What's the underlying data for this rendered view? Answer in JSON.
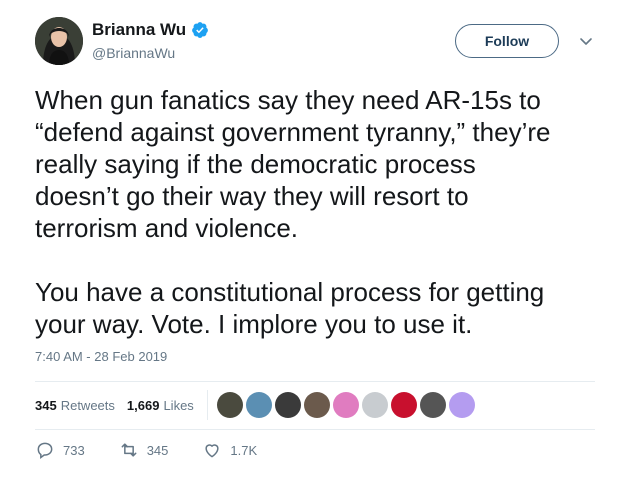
{
  "author": {
    "display_name": "Brianna Wu",
    "handle": "@BriannaWu",
    "verified_icon": "verified-badge-icon",
    "accent": "#1da1f2"
  },
  "header": {
    "follow_label": "Follow",
    "menu_icon": "chevron-down-icon"
  },
  "tweet": {
    "text": "When gun fanatics say they need AR-15s to\n“defend against government tyranny,” they’re\nreally saying if the democratic process\ndoesn’t go their way they will resort to\nterrorism and violence.\n\nYou have a constitutional process for getting\nyour way. Vote. I implore you to use it.",
    "timestamp": "7:40 AM - 28 Feb 2019"
  },
  "stats": {
    "retweets_count": "345",
    "retweets_label": "Retweets",
    "likes_count": "1,669",
    "likes_label": "Likes"
  },
  "likers": [
    {
      "name": "liker-avatar-1",
      "color": "#4a4a3e"
    },
    {
      "name": "liker-avatar-2",
      "color": "#5b8fb3"
    },
    {
      "name": "liker-avatar-3",
      "color": "#3a3a3a"
    },
    {
      "name": "liker-avatar-4",
      "color": "#6b5a4c"
    },
    {
      "name": "liker-avatar-5",
      "color": "#e07cc0"
    },
    {
      "name": "liker-avatar-6",
      "color": "#c8ccd0"
    },
    {
      "name": "liker-avatar-7",
      "color": "#c8102e"
    },
    {
      "name": "liker-avatar-8",
      "color": "#555555"
    },
    {
      "name": "liker-avatar-9",
      "color": "#b49cf0"
    }
  ],
  "actions": {
    "reply_count": "733",
    "retweet_count": "345",
    "like_count": "1.7K"
  }
}
